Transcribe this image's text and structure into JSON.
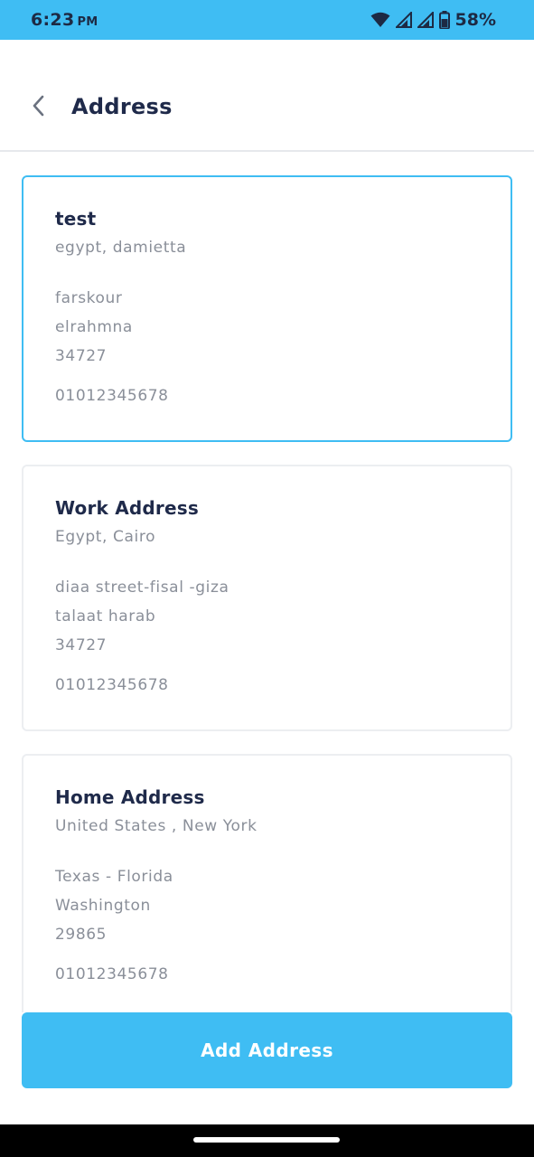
{
  "status_bar": {
    "time": "6:23",
    "ampm": "PM",
    "battery": "58%",
    "icons": [
      "wifi-icon",
      "signal-icon",
      "signal-icon",
      "battery-icon"
    ]
  },
  "header": {
    "title": "Address",
    "back_icon": "chevron-left-icon"
  },
  "addresses": [
    {
      "name": "test",
      "region": "egypt, damietta",
      "line1": "farskour",
      "line2": "elrahmna",
      "postal": "34727",
      "phone": "01012345678",
      "selected": true
    },
    {
      "name": "Work Address",
      "region": "Egypt, Cairo",
      "line1": "diaa street-fisal -giza",
      "line2": "talaat harab",
      "postal": "34727",
      "phone": "01012345678",
      "selected": false
    },
    {
      "name": "Home Address",
      "region": "United States , New York",
      "line1": "Texas - Florida",
      "line2": "Washington",
      "postal": "29865",
      "phone": "01012345678",
      "selected": false
    }
  ],
  "add_button": {
    "label": "Add Address"
  },
  "colors": {
    "accent": "#3FBDF3",
    "title_text": "#1f2a4a",
    "secondary_text": "#8a8f99"
  }
}
